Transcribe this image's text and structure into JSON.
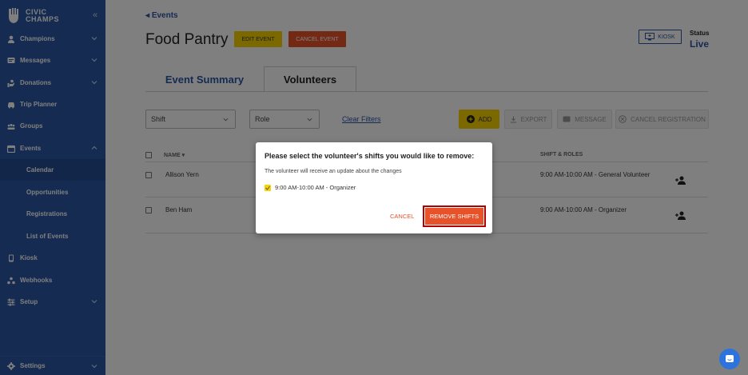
{
  "brand": {
    "line1": "CIVIC",
    "line2": "CHAMPS"
  },
  "sidebar": {
    "items": [
      {
        "label": "Champions",
        "icon": "champions-icon"
      },
      {
        "label": "Messages",
        "icon": "messages-icon"
      },
      {
        "label": "Donations",
        "icon": "donations-icon"
      },
      {
        "label": "Trip Planner",
        "icon": "trip-planner-icon"
      },
      {
        "label": "Groups",
        "icon": "groups-icon"
      },
      {
        "label": "Events",
        "icon": "events-icon"
      },
      {
        "label": "Kiosk",
        "icon": "kiosk-icon"
      },
      {
        "label": "Webhooks",
        "icon": "webhooks-icon"
      },
      {
        "label": "Setup",
        "icon": "setup-icon"
      }
    ],
    "events_sub": [
      "Calendar",
      "Opportunities",
      "Registrations",
      "List of Events"
    ],
    "settings": "Settings"
  },
  "header": {
    "back": "Events",
    "title": "Food Pantry",
    "edit_event": "EDIT EVENT",
    "cancel_event": "CANCEL EVENT",
    "kiosk": "KIOSK",
    "status_label": "Status",
    "status_value": "Live"
  },
  "tabs": [
    "Event Summary",
    "Volunteers"
  ],
  "filters": {
    "shift": "Shift",
    "role": "Role",
    "clear": "Clear Filters"
  },
  "toolbar": {
    "add": "ADD",
    "export": "EXPORT",
    "message": "MESSAGE",
    "cancel_registration": "CANCEL REGISTRATION"
  },
  "table": {
    "columns": [
      "NAME",
      "SHIFT & ROLES"
    ],
    "rows": [
      {
        "name": "Allison Yern",
        "shift": "9:00 AM-10:00 AM - General Volunteer"
      },
      {
        "name": "Ben Ham",
        "shift": "9:00 AM-10:00 AM - Organizer"
      }
    ]
  },
  "modal": {
    "title": "Please select the volunteer's shifts you would like to remove:",
    "description": "The volunteer will receive an update about the changes",
    "shift_option": "9:00 AM-10:00 AM - Organizer",
    "cancel": "CANCEL",
    "confirm": "REMOVE SHIFTS"
  },
  "colors": {
    "primary": "#2a56a4",
    "accent_yellow": "#f7d300",
    "accent_orange": "#e8522a",
    "highlight_border": "#b30000"
  }
}
